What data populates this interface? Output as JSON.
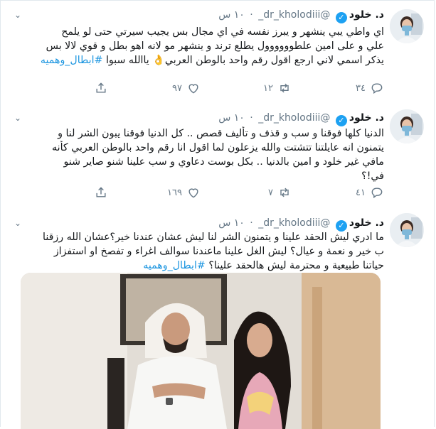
{
  "tweets": [
    {
      "name": "د. خلود",
      "handle": "@dr_kholodiii_",
      "time": "١٠ س",
      "lines": [
        "اي واطي يبي ينشهر و يبرز نفسه في اي مجال بس يجيب سيرتي حتى لو يلمح",
        "علي و على امين علطوووووول يطلع ترند و ينشهر مو لانه اهو بطل و قوي لالا بس",
        "يذكر اسمي لاني ارجع اقول رقم واحد بالوطن العربي👌 ياالله سبوا"
      ],
      "hashtag": "#ابطال_وهميه",
      "replies": "٣٤",
      "retweets": "١٢",
      "likes": "٩٧"
    },
    {
      "name": "د. خلود",
      "handle": "@dr_kholodiii_",
      "time": "١٠ س",
      "lines": [
        "الدنيا كلها فوقنا و سب و قذف و تأليف قصص .. كل الدنيا فوقنا يبون الشر لنا و",
        "يتمنون انه عايلتنا تتشتت والله يزعلون لما اقول انا رقم واحد بالوطن العربي كأنه",
        "مافي غير خلود و امين بالدنيا .. بكل بوست دعاوي و سب علينا شنو صاير شنو",
        "في!؟"
      ],
      "replies": "٤١",
      "retweets": "٧",
      "likes": "١٦٩"
    },
    {
      "name": "د. خلود",
      "handle": "@dr_kholodiii_",
      "time": "١٠ س",
      "lines": [
        "ما ادري ليش الحقد علينا و يتمنون الشر لنا ليش عشان عندنا خير؟عشان الله رزقنا",
        "ب خير و نعمة و عيال؟ ليش الغل علينا ماعندنا سوالف اغراء و تفصخ او استفزاز",
        "حياتنا طبيعية و محترمة ليش هالحقد علينا؟"
      ],
      "hashtag": "#ابطال_وهميه"
    }
  ],
  "icons": {
    "verified": "verified-check-icon",
    "menu": "chevron-down-icon",
    "reply": "reply-icon",
    "retweet": "retweet-icon",
    "like": "heart-icon",
    "share": "share-icon"
  },
  "colors": {
    "accent": "#1da1f2",
    "hashtag": "#1b95e0",
    "muted": "#657786",
    "border": "#e1e8ed"
  }
}
